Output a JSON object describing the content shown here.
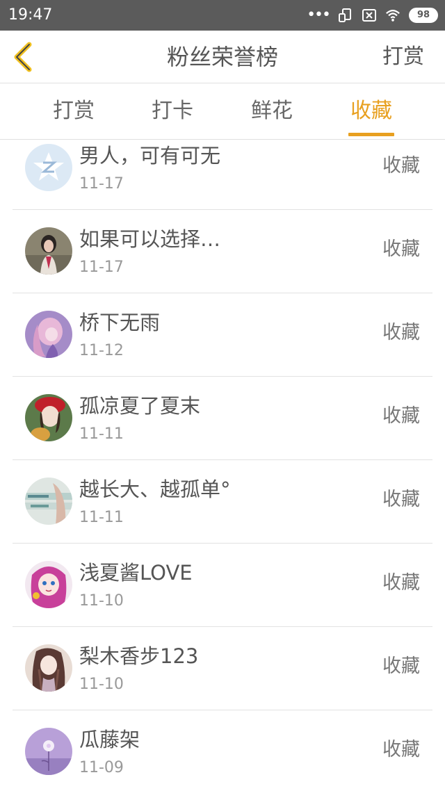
{
  "status_bar": {
    "time": "19:47",
    "battery": "98"
  },
  "header": {
    "title": "粉丝荣誉榜",
    "action": "打赏"
  },
  "tabs": [
    {
      "label": "打赏",
      "active": false
    },
    {
      "label": "打卡",
      "active": false
    },
    {
      "label": "鲜花",
      "active": false
    },
    {
      "label": "收藏",
      "active": true
    }
  ],
  "colors": {
    "accent": "#e8a020",
    "status_bar": "#5b5b5b"
  },
  "list": [
    {
      "name": "男人，可有可无",
      "date": "11-17",
      "action": "收藏"
    },
    {
      "name": "如果可以选择…",
      "date": "11-17",
      "action": "收藏"
    },
    {
      "name": "桥下无雨",
      "date": "11-12",
      "action": "收藏"
    },
    {
      "name": "孤凉夏了夏末",
      "date": "11-11",
      "action": "收藏"
    },
    {
      "name": "越长大、越孤单°",
      "date": "11-11",
      "action": "收藏"
    },
    {
      "name": "浅夏酱LOVE",
      "date": "11-10",
      "action": "收藏"
    },
    {
      "name": "梨木香步123",
      "date": "11-10",
      "action": "收藏"
    },
    {
      "name": "瓜藤架",
      "date": "11-09",
      "action": "收藏"
    }
  ]
}
